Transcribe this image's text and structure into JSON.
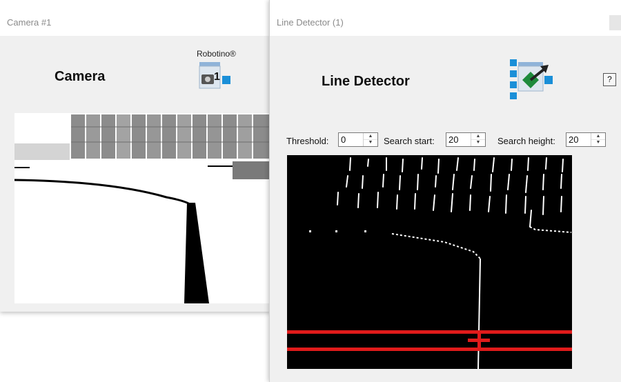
{
  "camera_window": {
    "title": "Camera #1",
    "heading": "Camera",
    "vendor_label": "Robotino®",
    "camera_number": "1",
    "icon": "camera-icon"
  },
  "line_detector_window": {
    "title": "Line Detector (1)",
    "heading": "Line Detector",
    "help_label": "?",
    "icon": "line-detector-icon",
    "controls": {
      "threshold_label": "Threshold:",
      "threshold_value": "0",
      "search_start_label": "Search start:",
      "search_start_value": "20",
      "search_height_label": "Search height:",
      "search_height_value": "20"
    }
  },
  "colors": {
    "detection_red": "#e01b1b",
    "icon_blue": "#1a8fd8",
    "icon_green": "#1e8a3c"
  }
}
